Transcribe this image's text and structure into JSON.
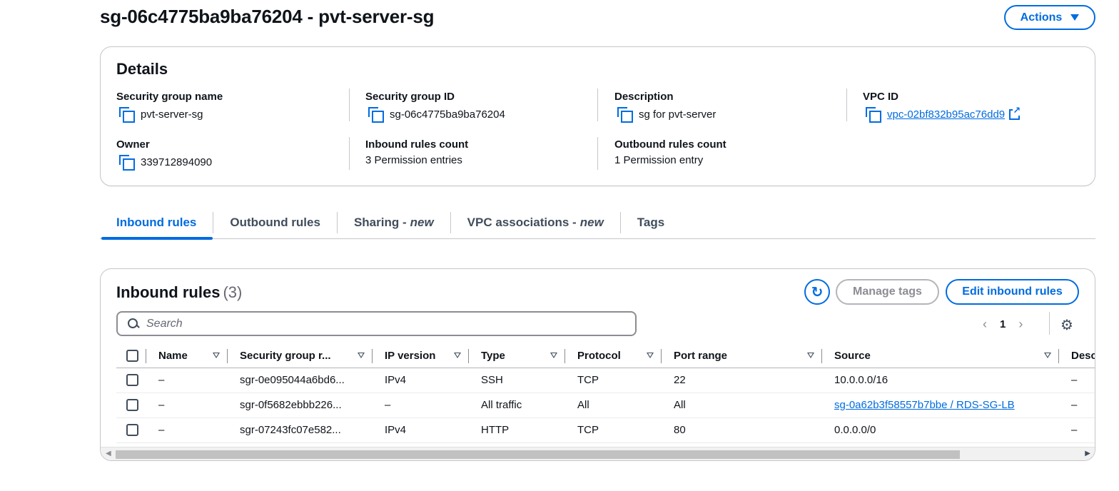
{
  "header": {
    "title": "sg-06c4775ba9ba76204 - pvt-server-sg",
    "actions_label": "Actions"
  },
  "details": {
    "title": "Details",
    "fields": {
      "sg_name": {
        "label": "Security group name",
        "value": "pvt-server-sg"
      },
      "sg_id": {
        "label": "Security group ID",
        "value": "sg-06c4775ba9ba76204"
      },
      "description": {
        "label": "Description",
        "value": "sg for pvt-server"
      },
      "vpc_id": {
        "label": "VPC ID",
        "value": "vpc-02bf832b95ac76dd9"
      },
      "owner": {
        "label": "Owner",
        "value": "339712894090"
      },
      "inbound_count": {
        "label": "Inbound rules count",
        "value": "3 Permission entries"
      },
      "outbound_count": {
        "label": "Outbound rules count",
        "value": "1 Permission entry"
      }
    }
  },
  "tabs": [
    {
      "label": "Inbound rules",
      "suffix": ""
    },
    {
      "label": "Outbound rules",
      "suffix": ""
    },
    {
      "label": "Sharing -",
      "suffix": "new"
    },
    {
      "label": "VPC associations -",
      "suffix": "new"
    },
    {
      "label": "Tags",
      "suffix": ""
    }
  ],
  "rules": {
    "title": "Inbound rules",
    "count": "(3)",
    "manage_tags_label": "Manage tags",
    "edit_label": "Edit inbound rules",
    "search_placeholder": "Search",
    "page": "1",
    "columns": [
      "Name",
      "Security group r...",
      "IP version",
      "Type",
      "Protocol",
      "Port range",
      "Source",
      "Desc"
    ],
    "rows": [
      {
        "name": "–",
        "sgr": "sgr-0e095044a6bd6...",
        "ip": "IPv4",
        "type": "SSH",
        "protocol": "TCP",
        "port": "22",
        "source": "10.0.0.0/16",
        "desc": "–"
      },
      {
        "name": "–",
        "sgr": "sgr-0f5682ebbb226...",
        "ip": "–",
        "type": "All traffic",
        "protocol": "All",
        "port": "All",
        "source": "sg-0a62b3f58557b7bbe / RDS-SG-LB",
        "desc": "–"
      },
      {
        "name": "–",
        "sgr": "sgr-07243fc07e582...",
        "ip": "IPv4",
        "type": "HTTP",
        "protocol": "TCP",
        "port": "80",
        "source": "0.0.0.0/0",
        "desc": "–"
      }
    ]
  },
  "colors": {
    "accent": "#006ce0",
    "text": "#0f141a",
    "border": "#c6c6cd"
  }
}
